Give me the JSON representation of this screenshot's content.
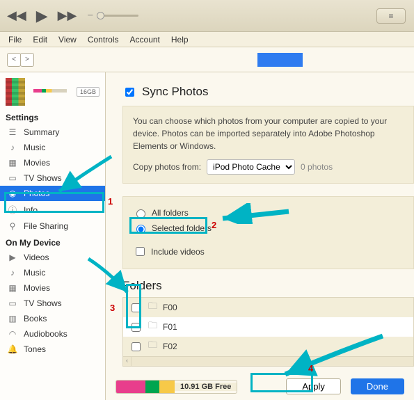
{
  "menubar": [
    "File",
    "Edit",
    "View",
    "Controls",
    "Account",
    "Help"
  ],
  "device": {
    "capacity_badge": "16GB"
  },
  "sidebar": {
    "settings_header": "Settings",
    "ondevice_header": "On My Device",
    "settings": [
      {
        "label": "Summary",
        "icon": "list"
      },
      {
        "label": "Music",
        "icon": "note"
      },
      {
        "label": "Movies",
        "icon": "film"
      },
      {
        "label": "TV Shows",
        "icon": "tv"
      },
      {
        "label": "Photos",
        "icon": "camera",
        "selected": true
      },
      {
        "label": "Info",
        "icon": "info"
      },
      {
        "label": "File Sharing",
        "icon": "share"
      }
    ],
    "on_device": [
      {
        "label": "Videos",
        "icon": "video"
      },
      {
        "label": "Music",
        "icon": "note"
      },
      {
        "label": "Movies",
        "icon": "film"
      },
      {
        "label": "TV Shows",
        "icon": "tv"
      },
      {
        "label": "Books",
        "icon": "book"
      },
      {
        "label": "Audiobooks",
        "icon": "headphones"
      },
      {
        "label": "Tones",
        "icon": "bell"
      }
    ]
  },
  "sync": {
    "title": "Sync Photos",
    "checked": true,
    "desc": "You can choose which photos from your computer are copied to your device. Photos can be imported separately into Adobe Photoshop Elements or Windows.",
    "copy_from_label": "Copy photos from:",
    "copy_from_value": "iPod Photo Cache",
    "photo_count": "0 photos",
    "option_all": "All folders",
    "option_selected": "Selected folders",
    "option_selected_checked": true,
    "include_videos": "Include videos",
    "folders_header": "Folders",
    "folders": [
      {
        "label": "F00",
        "checked": false
      },
      {
        "label": "F01",
        "checked": false
      },
      {
        "label": "F02",
        "checked": false
      }
    ]
  },
  "footer": {
    "free_space": "10.91 GB Free",
    "segments": [
      {
        "color": "#e83e8c",
        "w": 42
      },
      {
        "color": "#00a54f",
        "w": 20
      },
      {
        "color": "#f7c948",
        "w": 22
      }
    ],
    "apply": "Apply",
    "done": "Done"
  },
  "annotations": {
    "n1": "1",
    "n2": "2",
    "n3": "3",
    "n4": "4"
  }
}
